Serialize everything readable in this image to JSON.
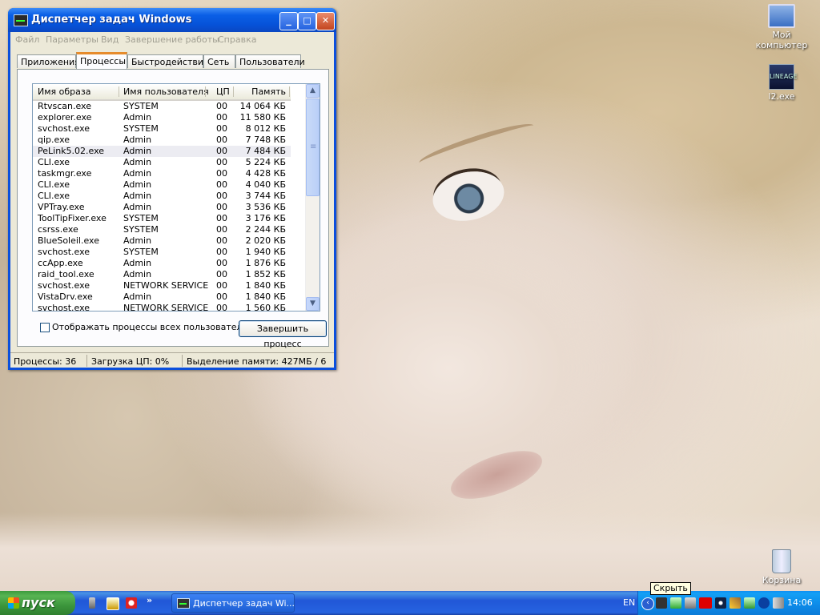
{
  "desktop": {
    "icons": [
      {
        "label": "Мой компьютер",
        "icon": "my-computer-icon"
      },
      {
        "label": "l2.exe",
        "icon": "l2-exe-icon",
        "badge": "LINEAGE"
      },
      {
        "label": "Корзина",
        "icon": "recycle-bin-icon"
      }
    ]
  },
  "window": {
    "title": "Диспетчер задач Windows",
    "buttons": {
      "minimize": "_",
      "maximize": "□",
      "close": "✕"
    },
    "menu": [
      "Файл",
      "Параметры",
      "Вид",
      "Завершение работы",
      "Справка"
    ],
    "tabs": [
      "Приложения",
      "Процессы",
      "Быстродействие",
      "Сеть",
      "Пользователи"
    ],
    "active_tab": "Процессы",
    "columns": [
      "Имя образа",
      "Имя пользователя",
      "ЦП",
      "Память"
    ],
    "processes": [
      {
        "name": "Rtvscan.exe",
        "user": "SYSTEM",
        "cpu": "00",
        "mem": "14 064 КБ"
      },
      {
        "name": "explorer.exe",
        "user": "Admin",
        "cpu": "00",
        "mem": "11 580 КБ"
      },
      {
        "name": "svchost.exe",
        "user": "SYSTEM",
        "cpu": "00",
        "mem": "8 012 КБ"
      },
      {
        "name": "qip.exe",
        "user": "Admin",
        "cpu": "00",
        "mem": "7 748 КБ"
      },
      {
        "name": "PeLink5.02.exe",
        "user": "Admin",
        "cpu": "00",
        "mem": "7 484 КБ"
      },
      {
        "name": "CLI.exe",
        "user": "Admin",
        "cpu": "00",
        "mem": "5 224 КБ"
      },
      {
        "name": "taskmgr.exe",
        "user": "Admin",
        "cpu": "00",
        "mem": "4 428 КБ"
      },
      {
        "name": "CLI.exe",
        "user": "Admin",
        "cpu": "00",
        "mem": "4 040 КБ"
      },
      {
        "name": "CLI.exe",
        "user": "Admin",
        "cpu": "00",
        "mem": "3 744 КБ"
      },
      {
        "name": "VPTray.exe",
        "user": "Admin",
        "cpu": "00",
        "mem": "3 536 КБ"
      },
      {
        "name": "ToolTipFixer.exe",
        "user": "SYSTEM",
        "cpu": "00",
        "mem": "3 176 КБ"
      },
      {
        "name": "csrss.exe",
        "user": "SYSTEM",
        "cpu": "00",
        "mem": "2 244 КБ"
      },
      {
        "name": "BlueSoleil.exe",
        "user": "Admin",
        "cpu": "00",
        "mem": "2 020 КБ"
      },
      {
        "name": "svchost.exe",
        "user": "SYSTEM",
        "cpu": "00",
        "mem": "1 940 КБ"
      },
      {
        "name": "ccApp.exe",
        "user": "Admin",
        "cpu": "00",
        "mem": "1 876 КБ"
      },
      {
        "name": "raid_tool.exe",
        "user": "Admin",
        "cpu": "00",
        "mem": "1 852 КБ"
      },
      {
        "name": "svchost.exe",
        "user": "NETWORK SERVICE",
        "cpu": "00",
        "mem": "1 840 КБ"
      },
      {
        "name": "VistaDrv.exe",
        "user": "Admin",
        "cpu": "00",
        "mem": "1 840 КБ"
      },
      {
        "name": "svchost.exe",
        "user": "NETWORK SERVICE",
        "cpu": "00",
        "mem": "1 560 КБ"
      }
    ],
    "selected_index": 4,
    "show_all_users_label": "Отображать процессы всех пользователей",
    "show_all_users_checked": false,
    "end_process_label": "Завершить процесс",
    "status": {
      "processes": "Процессы: 36",
      "cpu": "Загрузка ЦП: 0%",
      "memory": "Выделение памяти: 427МБ / 6"
    }
  },
  "taskbar": {
    "start_label": "пуск",
    "quick_launch_more": "»",
    "task_button_label": "Диспетчер задач Wi...",
    "language": "EN",
    "tooltip": "Скрыть",
    "clock": "14:06",
    "tray_icons": [
      "expand-arrow-icon",
      "device-icon",
      "network-icon",
      "network-icon",
      "ati-icon",
      "display-icon",
      "pen-icon",
      "battery-icon",
      "bluetooth-icon",
      "volume-icon"
    ]
  }
}
